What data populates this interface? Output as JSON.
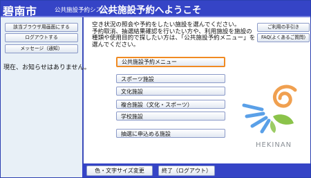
{
  "header": {
    "city": "碧南市",
    "system": "公共施設予約システム",
    "welcome": "公共施設予約へようこそ"
  },
  "sidebar": {
    "buttons": [
      "該当ブラウザ用画面にする",
      "ログアウトする",
      "メッセージ（通知）"
    ],
    "notice": "現在、お知らせはありません。"
  },
  "intro": {
    "lines": [
      "空き状況の照会や予約をしたい施設を選んでください。",
      "予約取消、抽選結果確認を行いたい方や、利用施設を施設の",
      "種類や使用目的で探したい方は、「公共施設予約メニュー」を",
      "選んでください。"
    ]
  },
  "right_buttons": [
    "ご利用の手引き",
    "FAQ(よくあるご質問)"
  ],
  "menu": {
    "primary": "公共施設予約メニュー",
    "items": [
      "スポーツ施設",
      "文化施設",
      "複合施設（文化・スポーツ）",
      "学校施設",
      "抽選に申込める施設"
    ]
  },
  "logo": {
    "text": "HEKINAN",
    "colors": {
      "blue": "#5aa0e8",
      "orange": "#f0a050",
      "green": "#8bc34a"
    }
  },
  "footer": {
    "buttons": [
      "色・文字サイズ変更",
      "終了（ログアウト）"
    ]
  },
  "colors": {
    "header_bg": "#3544c6",
    "sidebar_bg": "#e8f0f7",
    "primary_border": "#f08a22"
  }
}
